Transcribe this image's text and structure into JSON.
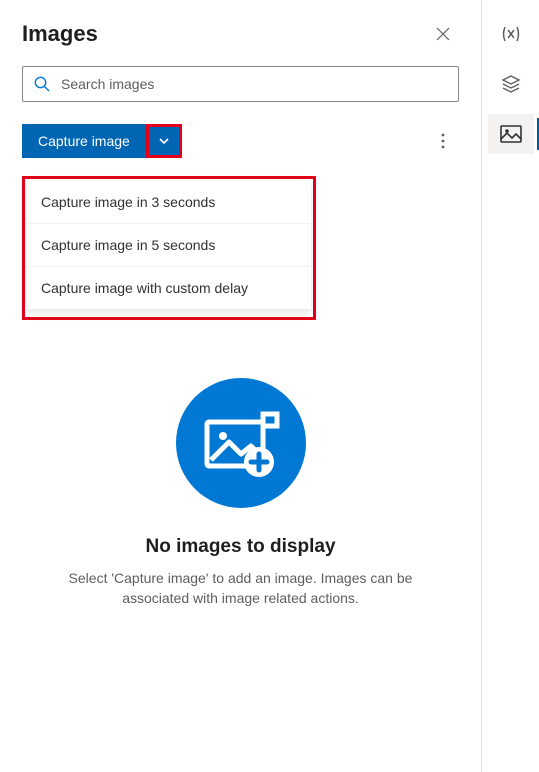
{
  "panel": {
    "title": "Images"
  },
  "search": {
    "placeholder": "Search images"
  },
  "toolbar": {
    "capture_label": "Capture image"
  },
  "dropdown": {
    "items": [
      {
        "label": "Capture image in 3 seconds"
      },
      {
        "label": "Capture image in 5 seconds"
      },
      {
        "label": "Capture image with custom delay"
      }
    ]
  },
  "empty": {
    "title": "No images to display",
    "description": "Select 'Capture image' to add an image. Images can be associated with image related actions."
  }
}
